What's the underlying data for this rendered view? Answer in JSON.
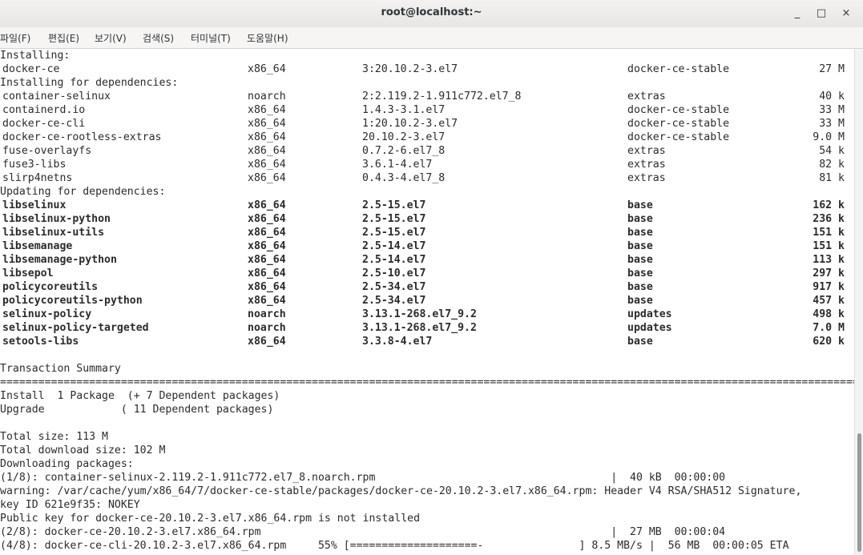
{
  "window": {
    "title": "root@localhost:~"
  },
  "controls": {
    "minimize": "_",
    "maximize": "□",
    "close": "×"
  },
  "menu": [
    "파일(F)",
    "편집(E)",
    "보기(V)",
    "검색(S)",
    "터미널(T)",
    "도움말(H)"
  ],
  "terminal": {
    "installing_header": "Installing:",
    "installing": [
      {
        "name": "docker-ce",
        "arch": "x86_64",
        "version": "3:20.10.2-3.el7",
        "repo": "docker-ce-stable",
        "size": "27 M",
        "bold": false
      }
    ],
    "deps_header": "Installing for dependencies:",
    "deps": [
      {
        "name": "container-selinux",
        "arch": "noarch",
        "version": "2:2.119.2-1.911c772.el7_8",
        "repo": "extras",
        "size": "40 k",
        "bold": false
      },
      {
        "name": "containerd.io",
        "arch": "x86_64",
        "version": "1.4.3-3.1.el7",
        "repo": "docker-ce-stable",
        "size": "33 M",
        "bold": false
      },
      {
        "name": "docker-ce-cli",
        "arch": "x86_64",
        "version": "1:20.10.2-3.el7",
        "repo": "docker-ce-stable",
        "size": "33 M",
        "bold": false
      },
      {
        "name": "docker-ce-rootless-extras",
        "arch": "x86_64",
        "version": "20.10.2-3.el7",
        "repo": "docker-ce-stable",
        "size": "9.0 M",
        "bold": false
      },
      {
        "name": "fuse-overlayfs",
        "arch": "x86_64",
        "version": "0.7.2-6.el7_8",
        "repo": "extras",
        "size": "54 k",
        "bold": false
      },
      {
        "name": "fuse3-libs",
        "arch": "x86_64",
        "version": "3.6.1-4.el7",
        "repo": "extras",
        "size": "82 k",
        "bold": false
      },
      {
        "name": "slirp4netns",
        "arch": "x86_64",
        "version": "0.4.3-4.el7_8",
        "repo": "extras",
        "size": "81 k",
        "bold": false
      }
    ],
    "updating_header": "Updating for dependencies:",
    "updating": [
      {
        "name": "libselinux",
        "arch": "x86_64",
        "version": "2.5-15.el7",
        "repo": "base",
        "size": "162 k",
        "bold": true
      },
      {
        "name": "libselinux-python",
        "arch": "x86_64",
        "version": "2.5-15.el7",
        "repo": "base",
        "size": "236 k",
        "bold": true
      },
      {
        "name": "libselinux-utils",
        "arch": "x86_64",
        "version": "2.5-15.el7",
        "repo": "base",
        "size": "151 k",
        "bold": true
      },
      {
        "name": "libsemanage",
        "arch": "x86_64",
        "version": "2.5-14.el7",
        "repo": "base",
        "size": "151 k",
        "bold": true
      },
      {
        "name": "libsemanage-python",
        "arch": "x86_64",
        "version": "2.5-14.el7",
        "repo": "base",
        "size": "113 k",
        "bold": true
      },
      {
        "name": "libsepol",
        "arch": "x86_64",
        "version": "2.5-10.el7",
        "repo": "base",
        "size": "297 k",
        "bold": true
      },
      {
        "name": "policycoreutils",
        "arch": "x86_64",
        "version": "2.5-34.el7",
        "repo": "base",
        "size": "917 k",
        "bold": true
      },
      {
        "name": "policycoreutils-python",
        "arch": "x86_64",
        "version": "2.5-34.el7",
        "repo": "base",
        "size": "457 k",
        "bold": true
      },
      {
        "name": "selinux-policy",
        "arch": "noarch",
        "version": "3.13.1-268.el7_9.2",
        "repo": "updates",
        "size": "498 k",
        "bold": true
      },
      {
        "name": "selinux-policy-targeted",
        "arch": "noarch",
        "version": "3.13.1-268.el7_9.2",
        "repo": "updates",
        "size": "7.0 M",
        "bold": true
      },
      {
        "name": "setools-libs",
        "arch": "x86_64",
        "version": "3.3.8-4.el7",
        "repo": "base",
        "size": "620 k",
        "bold": true
      }
    ],
    "summary_title": "Transaction Summary",
    "separator": "================================================================================================================================================================",
    "summary": [
      "Install  1 Package  (+ 7 Dependent packages)",
      "Upgrade            ( 11 Dependent packages)",
      "",
      "Total size: 113 M",
      "Total download size: 102 M",
      "Downloading packages:",
      "(1/8): container-selinux-2.119.2-1.911c772.el7_8.noarch.rpm                                     |  40 kB  00:00:00",
      "warning: /var/cache/yum/x86_64/7/docker-ce-stable/packages/docker-ce-20.10.2-3.el7.x86_64.rpm: Header V4 RSA/SHA512 Signature,",
      "key ID 621e9f35: NOKEY",
      "Public key for docker-ce-20.10.2-3.el7.x86_64.rpm is not installed",
      "(2/8): docker-ce-20.10.2-3.el7.x86_64.rpm                                                       |  27 MB  00:00:04",
      "(4/8): docker-ce-cli-20.10.2-3.el7.x86_64.rpm     55% [====================-               ] 8.5 MB/s |  56 MB  00:00:05 ETA"
    ]
  }
}
